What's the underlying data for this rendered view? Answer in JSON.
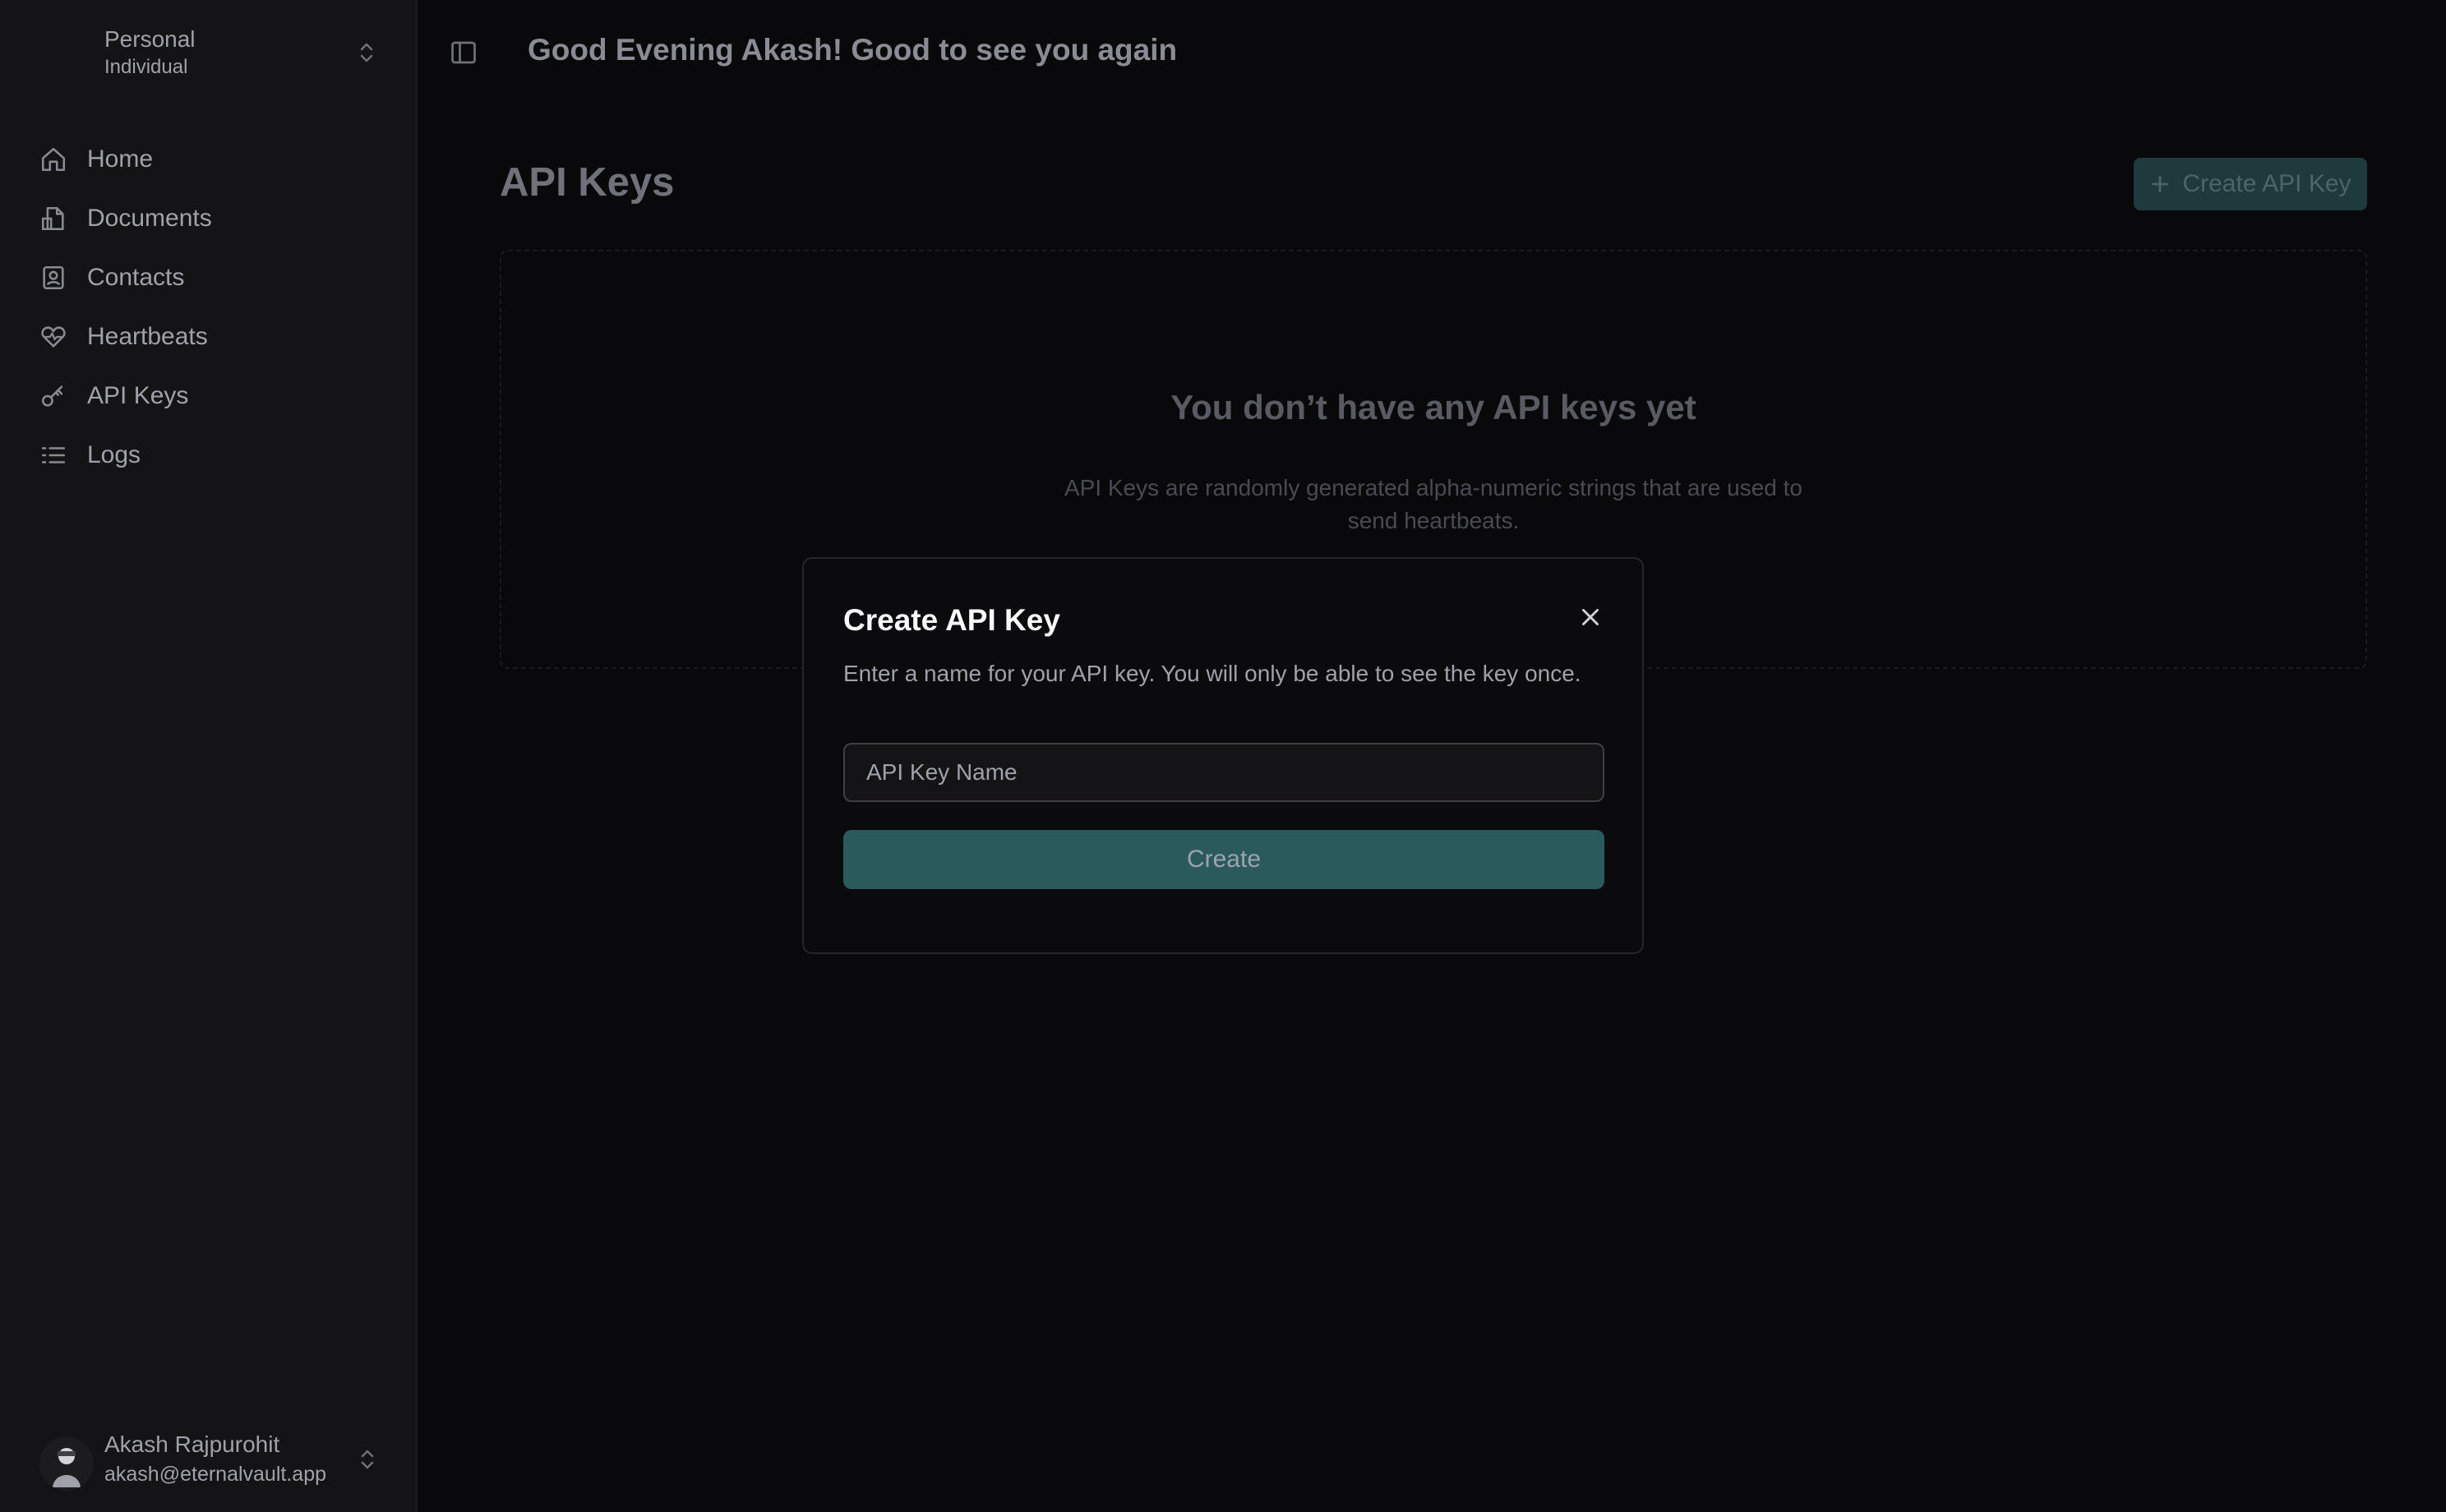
{
  "workspace": {
    "name": "Personal",
    "type": "Individual"
  },
  "sidebar": {
    "items": [
      {
        "label": "Home",
        "icon": "home-icon"
      },
      {
        "label": "Documents",
        "icon": "documents-icon"
      },
      {
        "label": "Contacts",
        "icon": "contacts-icon"
      },
      {
        "label": "Heartbeats",
        "icon": "heartbeat-icon"
      },
      {
        "label": "API Keys",
        "icon": "key-icon"
      },
      {
        "label": "Logs",
        "icon": "list-icon"
      }
    ]
  },
  "user": {
    "name": "Akash Rajpurohit",
    "email": "akash@eternalvault.app"
  },
  "header": {
    "greeting": "Good Evening Akash! Good to see you again"
  },
  "main": {
    "title": "API Keys",
    "create_button": "Create API Key",
    "empty_title": "You don’t have any API keys yet",
    "empty_description": "API Keys are randomly generated alpha-numeric strings that are used to send heartbeats."
  },
  "modal": {
    "title": "Create API Key",
    "description": "Enter a name for your API key. You will only be able to see the key once.",
    "input_placeholder": "API Key Name",
    "input_value": "",
    "submit_label": "Create"
  },
  "colors": {
    "background": "#09090b",
    "sidebar": "#141416",
    "accent": "#2a5a5c"
  }
}
